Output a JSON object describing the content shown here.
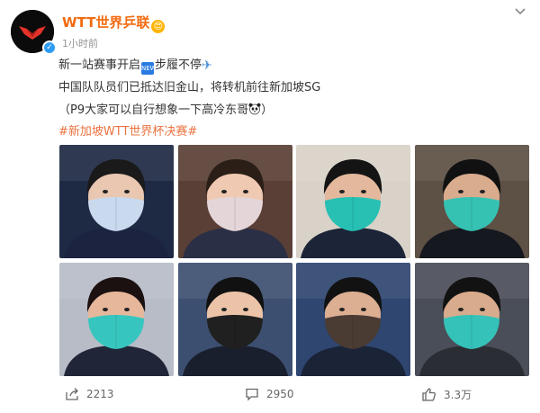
{
  "post": {
    "author": "WTT世界乒联",
    "author_badge": "😍",
    "time": "1小时前",
    "lines": [
      "新一站赛事开启",
      "步履不停",
      "中国队队员们已抵达旧金山，将转机前往新加坡SG",
      "（P9大家可以自行想象一下高冷东哥",
      "）",
      "#新加坡WTT世界杯决赛#"
    ],
    "inline_emoji_text": "NEW",
    "icons": {
      "avatar": "wtt-logo-icon",
      "verified": "verified-icon",
      "more": "chevron-down-icon",
      "plane": "airplane-icon",
      "panda": "panda-icon"
    }
  },
  "photos": [
    {
      "bg": "#1e2a44",
      "hair": "#1a1a1a",
      "skin": "#e9c7b0",
      "mask": "#c9d9ee",
      "shirt": "#1b2340"
    },
    {
      "bg": "#5a3f36",
      "hair": "#2a1e16",
      "skin": "#f0c9b2",
      "mask": "#e4d5d8",
      "shirt": "#2a2f45"
    },
    {
      "bg": "#d8d2c8",
      "hair": "#141414",
      "skin": "#e3b89c",
      "mask": "#27c0b3",
      "shirt": "#1c2438"
    },
    {
      "bg": "#5d5044",
      "hair": "#111111",
      "skin": "#d9ac8e",
      "mask": "#36c2b3",
      "shirt": "#15181f"
    },
    {
      "bg": "#b7bcc7",
      "hair": "#1a1110",
      "skin": "#e6b79b",
      "mask": "#37c6bf",
      "shirt": "#202638"
    },
    {
      "bg": "#3d4f70",
      "hair": "#111111",
      "skin": "#ebc3a8",
      "mask": "#202020",
      "shirt": "#1a1f2e"
    },
    {
      "bg": "#2e4670",
      "hair": "#121212",
      "skin": "#dcae92",
      "mask": "#4a3b33",
      "shirt": "#1b2337"
    },
    {
      "bg": "#4a4e58",
      "hair": "#121212",
      "skin": "#d9ab8d",
      "mask": "#35c2b8",
      "shirt": "#2a2d33"
    }
  ],
  "actions": {
    "share_count": "2213",
    "comment_count": "2950",
    "like_count": "3.3万"
  },
  "colors": {
    "author": "#f16b10",
    "hashtag": "#eb7340",
    "meta": "#939393"
  }
}
